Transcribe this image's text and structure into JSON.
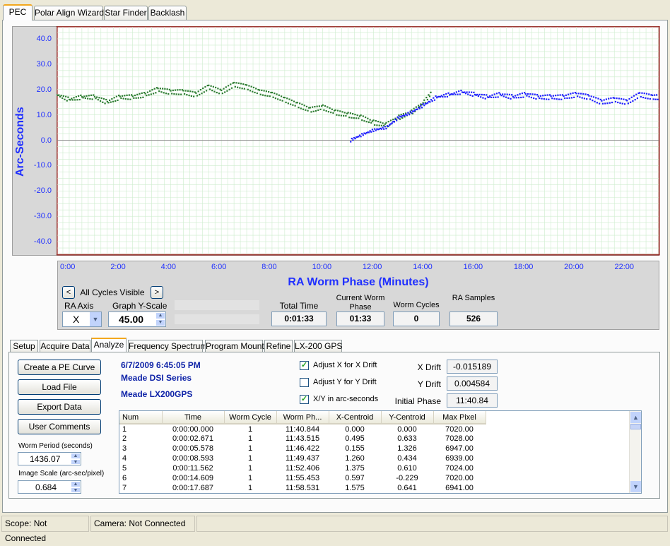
{
  "tabs": [
    "PEC",
    "Polar Align Wizard",
    "Star Finder",
    "Backlash"
  ],
  "chart_data": {
    "type": "scatter",
    "ylabel": "Arc-Seconds",
    "xlabel": "RA Worm Phase (Minutes)",
    "ylim": [
      -45,
      45
    ],
    "xlim": [
      0,
      23.75
    ],
    "yticks": [
      "40.0",
      "30.0",
      "20.0",
      "10.0",
      "0.0",
      "-10.0",
      "-20.0",
      "-30.0",
      "-40.0"
    ],
    "xticks": [
      "0:00",
      "2:00",
      "4:00",
      "6:00",
      "8:00",
      "10:00",
      "12:00",
      "14:00",
      "16:00",
      "18:00",
      "20:00",
      "22:00"
    ],
    "grid": true,
    "series": [
      {
        "color": "#2e7d32",
        "x": [
          0.0,
          0.5,
          1.0,
          1.5,
          2.0,
          2.5,
          3.0,
          3.5,
          4.0,
          4.5,
          5.0,
          5.5,
          6.0,
          6.5,
          7.0,
          7.5,
          8.0,
          8.5,
          9.0,
          9.5,
          10.0,
          10.5,
          11.0,
          11.5,
          12.0,
          12.5,
          13.0,
          13.5,
          14.0,
          14.5,
          14.8
        ],
        "y": [
          18,
          16,
          17,
          17,
          15,
          17,
          17,
          18,
          20,
          19,
          19,
          18,
          21,
          19,
          22,
          21,
          19,
          18,
          16,
          14,
          12,
          13,
          11,
          10,
          9,
          7,
          6,
          9,
          11,
          15,
          19
        ]
      },
      {
        "color": "#2020ff",
        "x": [
          11.6,
          12.0,
          12.5,
          13.0,
          13.5,
          14.0,
          14.5,
          15.0,
          15.5,
          16.0,
          16.5,
          17.0,
          17.5,
          18.0,
          18.5,
          19.0,
          19.5,
          20.0,
          20.5,
          21.0,
          21.5,
          22.0,
          22.5,
          23.0,
          23.5,
          23.75
        ],
        "y": [
          0,
          2,
          4,
          5,
          9,
          11,
          14,
          17,
          18,
          19,
          18,
          17,
          18,
          17,
          18,
          17,
          17,
          17,
          18,
          17,
          15,
          16,
          15,
          18,
          17,
          17
        ]
      }
    ]
  },
  "cycles": {
    "label": "All Cycles Visible",
    "prev": "<",
    "next": ">"
  },
  "ra_axis": {
    "label": "RA Axis",
    "value": "X"
  },
  "graph_yscale": {
    "label": "Graph Y-Scale",
    "value": "45.00"
  },
  "stats": [
    {
      "label": "Total Time",
      "value": "0:01:33"
    },
    {
      "label": "Current Worm Phase",
      "value": "01:33"
    },
    {
      "label": "Worm Cycles",
      "value": "0"
    },
    {
      "label": "RA Samples",
      "value": "526"
    }
  ],
  "subtabs": [
    "Setup",
    "Acquire Data",
    "Analyze",
    "Frequency Spectrum",
    "Program Mount",
    "Refine",
    "LX-200 GPS"
  ],
  "buttons": [
    "Create a PE Curve",
    "Load File",
    "Export Data",
    "User Comments"
  ],
  "worm_period": {
    "label": "Worm Period (seconds)",
    "value": "1436.07"
  },
  "image_scale": {
    "label": "Image Scale (arc-sec/pixel)",
    "value": "0.684"
  },
  "info": {
    "datetime": "6/7/2009 6:45:05 PM",
    "camera": "Meade DSI Series",
    "mount": "Meade LX200GPS"
  },
  "checkboxes": [
    {
      "label": "Adjust X for X Drift",
      "checked": "✓"
    },
    {
      "label": "Adjust Y for Y Drift",
      "checked": ""
    },
    {
      "label": "X/Y in arc-seconds",
      "checked": "✓"
    }
  ],
  "drift": [
    {
      "label": "X Drift",
      "value": "-0.015189"
    },
    {
      "label": "Y Drift",
      "value": "0.004584"
    },
    {
      "label": "Initial Phase",
      "value": "11:40.84"
    }
  ],
  "table": {
    "columns": [
      "Num",
      "Time",
      "Worm Cycle",
      "Worm Ph...",
      "X-Centroid",
      "Y-Centroid",
      "Max Pixel"
    ],
    "rows": [
      [
        "1",
        "0:00:00.000",
        "1",
        "11:40.844",
        "0.000",
        "0.000",
        "7020.00"
      ],
      [
        "2",
        "0:00:02.671",
        "1",
        "11:43.515",
        "0.495",
        "0.633",
        "7028.00"
      ],
      [
        "3",
        "0:00:05.578",
        "1",
        "11:46.422",
        "0.155",
        "1.326",
        "6947.00"
      ],
      [
        "4",
        "0:00:08.593",
        "1",
        "11:49.437",
        "1.260",
        "0.434",
        "6939.00"
      ],
      [
        "5",
        "0:00:11.562",
        "1",
        "11:52.406",
        "1.375",
        "0.610",
        "7024.00"
      ],
      [
        "6",
        "0:00:14.609",
        "1",
        "11:55.453",
        "0.597",
        "-0.229",
        "7020.00"
      ],
      [
        "7",
        "0:00:17.687",
        "1",
        "11:58.531",
        "1.575",
        "0.641",
        "6941.00"
      ]
    ]
  },
  "status": {
    "scope": "Scope: Not Connected",
    "camera": "Camera: Not Connected"
  }
}
